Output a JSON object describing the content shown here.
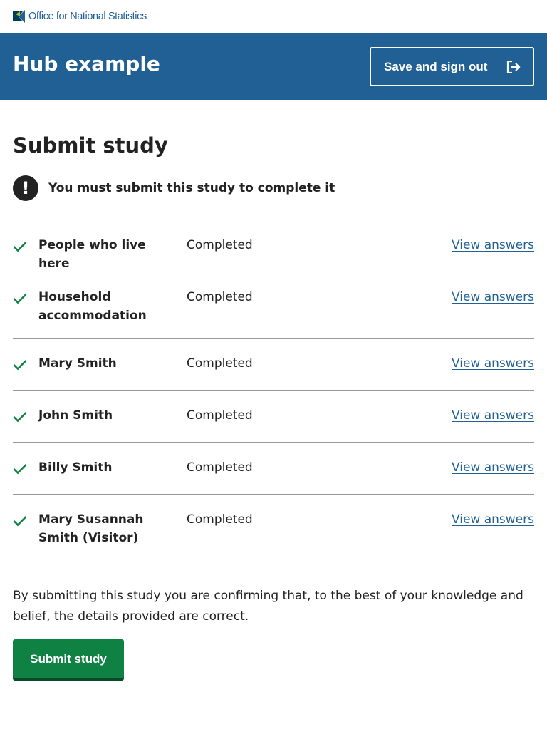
{
  "logo": {
    "text": "Office for National Statistics",
    "colors": {
      "primary": "#206095",
      "dark": "#003c57",
      "accent": "#a8bd3a"
    }
  },
  "header": {
    "title": "Hub example",
    "signout_label": "Save and sign out",
    "background": "#206095"
  },
  "page": {
    "title": "Submit study"
  },
  "alert": {
    "icon": "!",
    "text": "You must submit this study to complete it"
  },
  "summary": {
    "rows": [
      {
        "name": "People who live here",
        "status": "Completed",
        "link": "View answers"
      },
      {
        "name": "Household accommodation",
        "status": "Completed",
        "link": "View answers"
      },
      {
        "name": "Mary Smith",
        "status": "Completed",
        "link": "View answers"
      },
      {
        "name": "John Smith",
        "status": "Completed",
        "link": "View answers"
      },
      {
        "name": "Billy Smith",
        "status": "Completed",
        "link": "View answers"
      },
      {
        "name": "Mary Susannah Smith (Visitor)",
        "status": "Completed",
        "link": "View answers"
      }
    ],
    "tick_color": "#0f8243",
    "link_color": "#206095"
  },
  "declaration": {
    "text": "By submitting this study you are confirming that, to the best of your knowledge and belief, the details provided are correct."
  },
  "submit": {
    "label": "Submit study",
    "color": "#0f8243"
  }
}
